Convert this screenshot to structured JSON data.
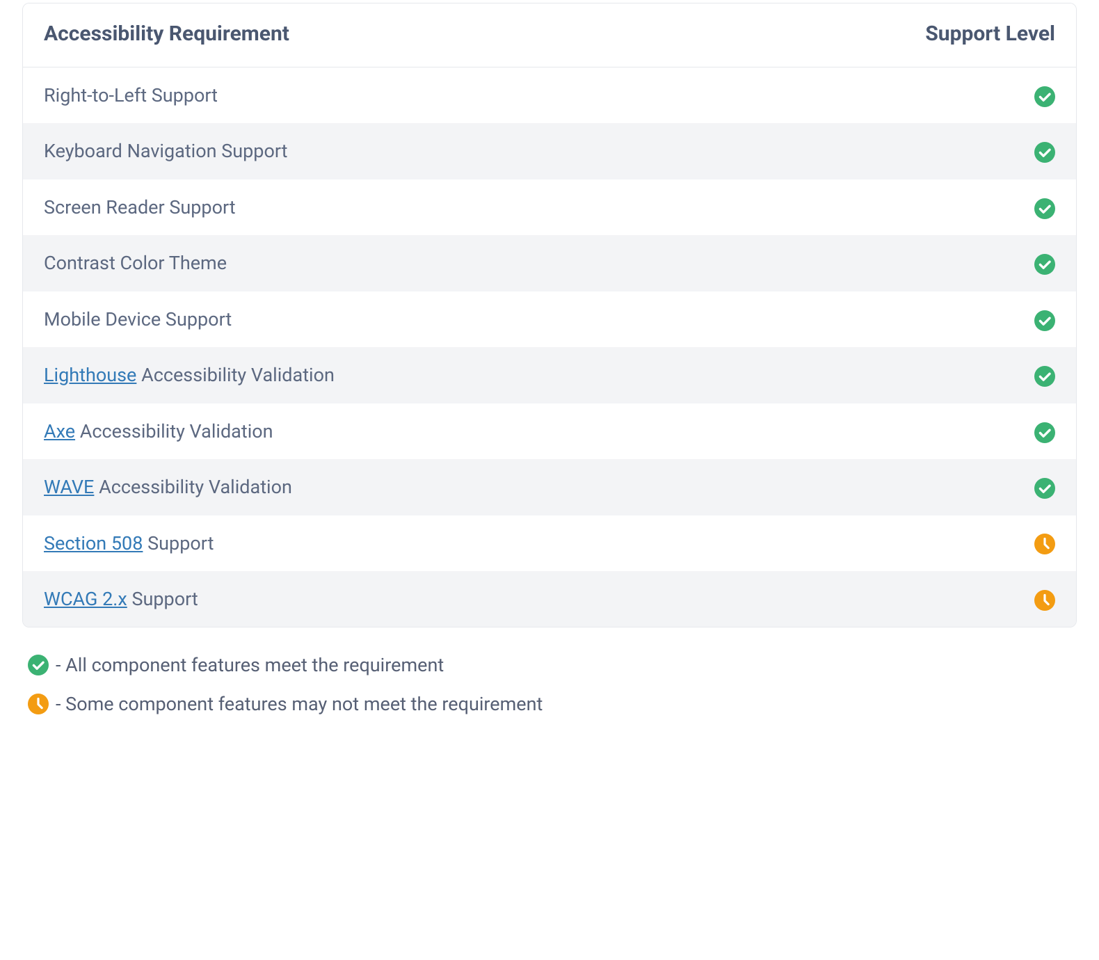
{
  "table": {
    "headers": {
      "requirement": "Accessibility Requirement",
      "support": "Support Level"
    },
    "rows": [
      {
        "text": "Right-to-Left Support",
        "link": null,
        "status": "full"
      },
      {
        "text": "Keyboard Navigation Support",
        "link": null,
        "status": "full"
      },
      {
        "text": "Screen Reader Support",
        "link": null,
        "status": "full"
      },
      {
        "text": "Contrast Color Theme",
        "link": null,
        "status": "full"
      },
      {
        "text": "Mobile Device Support",
        "link": null,
        "status": "full"
      },
      {
        "text": " Accessibility Validation",
        "link": "Lighthouse",
        "status": "full"
      },
      {
        "text": " Accessibility Validation",
        "link": "Axe",
        "status": "full"
      },
      {
        "text": " Accessibility Validation",
        "link": "WAVE",
        "status": "full"
      },
      {
        "text": " Support",
        "link": "Section 508",
        "status": "partial"
      },
      {
        "text": " Support",
        "link": "WCAG 2.x",
        "status": "partial"
      }
    ]
  },
  "legend": {
    "full_label": " - All component features meet the requirement",
    "partial_label": " - Some component features may not meet the requirement"
  },
  "icons": {
    "full": {
      "name": "check-circle-icon",
      "color": "#3bb273"
    },
    "partial": {
      "name": "clock-icon",
      "color": "#f39c12"
    }
  }
}
